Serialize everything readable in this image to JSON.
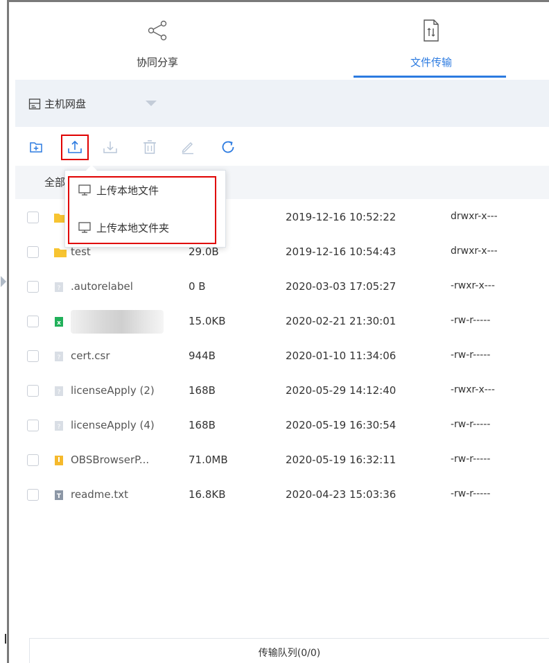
{
  "tabs": {
    "share_label": "协同分享",
    "transfer_label": "文件传输",
    "share_icon": "share-icon",
    "transfer_icon": "transfer-file-icon",
    "active": "文件传输",
    "accent": "#2b7ae0"
  },
  "drive": {
    "icon": "drive-icon",
    "label": "主机网盘"
  },
  "toolbar": {
    "new_folder_icon": "new-folder-icon",
    "upload_icon": "upload-icon",
    "download_icon": "download-icon",
    "delete_icon": "delete-icon",
    "rename_icon": "edit-icon",
    "refresh_icon": "refresh-icon"
  },
  "table": {
    "header_all": "全部"
  },
  "upload_menu": {
    "items": [
      {
        "icon": "monitor-icon",
        "label": "上传本地文件"
      },
      {
        "icon": "monitor-icon",
        "label": "上传本地文件夹"
      }
    ],
    "highlight_color": "#e00000"
  },
  "files": [
    {
      "icon": "folder-icon",
      "name": "",
      "size": "",
      "date": "2019-12-16 10:52:22",
      "perm": "drwxr-x---"
    },
    {
      "icon": "folder-icon",
      "name": "test",
      "size": "29.0B",
      "date": "2019-12-16 10:54:43",
      "perm": "drwxr-x---"
    },
    {
      "icon": "unknown-file-icon",
      "name": ".autorelabel",
      "size": "0 B",
      "date": "2020-03-03 17:05:27",
      "perm": "-rwxr-x---"
    },
    {
      "icon": "excel-file-icon",
      "name": "",
      "size": "15.0KB",
      "date": "2020-02-21 21:30:01",
      "perm": "-rw-r-----"
    },
    {
      "icon": "unknown-file-icon",
      "name": "cert.csr",
      "size": "944B",
      "date": "2020-01-10 11:34:06",
      "perm": "-rw-r-----"
    },
    {
      "icon": "unknown-file-icon",
      "name": "licenseApply (2)",
      "size": "168B",
      "date": "2020-05-29 14:12:40",
      "perm": "-rwxr-x---"
    },
    {
      "icon": "unknown-file-icon",
      "name": "licenseApply (4)",
      "size": "168B",
      "date": "2020-05-19 16:30:54",
      "perm": "-rw-r-----"
    },
    {
      "icon": "archive-file-icon",
      "name": "OBSBrowserP...",
      "size": "71.0MB",
      "date": "2020-05-19 16:32:11",
      "perm": "-rw-r-----"
    },
    {
      "icon": "text-file-icon",
      "name": "readme.txt",
      "size": "16.8KB",
      "date": "2020-04-23 15:03:36",
      "perm": "-rw-r-----"
    }
  ],
  "queue": {
    "label": "传输队列(0/0)"
  }
}
